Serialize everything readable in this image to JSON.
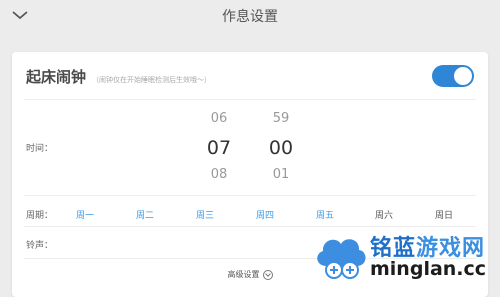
{
  "header": {
    "title": "作息设置",
    "back_icon": "chevron-down-icon"
  },
  "alarm": {
    "title": "起床闹钟",
    "hint": "（闹钟仅在开始睡眠检测后生效哦～）",
    "enabled": true,
    "accent_color": "#2f86d6"
  },
  "time": {
    "label": "时间：",
    "hour": {
      "prev": "06",
      "selected": "07",
      "next": "08"
    },
    "minute": {
      "prev": "59",
      "selected": "00",
      "next": "01"
    }
  },
  "repeat": {
    "label": "周期：",
    "days": [
      {
        "label": "周一",
        "active": true
      },
      {
        "label": "周二",
        "active": true
      },
      {
        "label": "周三",
        "active": true
      },
      {
        "label": "周四",
        "active": true
      },
      {
        "label": "周五",
        "active": true
      },
      {
        "label": "周六",
        "active": false
      },
      {
        "label": "周日",
        "active": false
      }
    ],
    "active_color": "#3d9bea"
  },
  "ringtone": {
    "label": "铃声："
  },
  "advanced": {
    "label": "高级设置"
  },
  "watermark": {
    "cn_brand": "铭蓝",
    "cn_rest": "游戏网",
    "en": "minglan.cc"
  }
}
